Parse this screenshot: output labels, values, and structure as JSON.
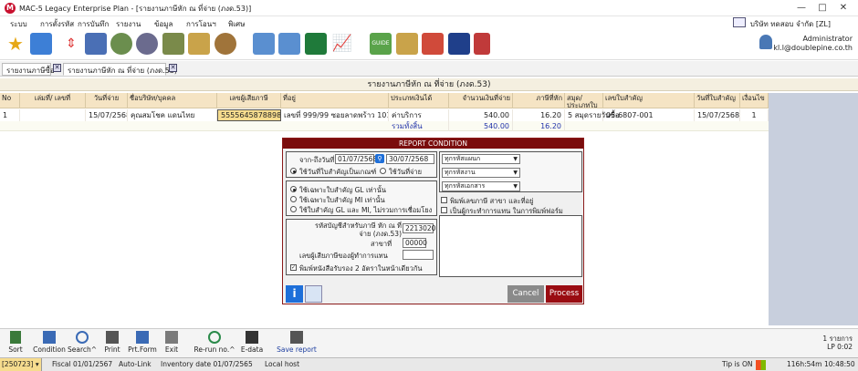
{
  "window": {
    "title": "MAC-5 Legacy Enterprise Plan - [รายงานภาษีหัก ณ ที่จ่าย (ภงด.53)]",
    "logo_letter": "M"
  },
  "menu": {
    "items": [
      "ระบบ",
      "การตั้งรหัส",
      "การบันทึก",
      "รายงาน",
      "ข้อมูล",
      "การโอนฯ",
      "พิเศษ"
    ]
  },
  "company": {
    "name": "บริษัท ทดสอบ จำกัด [ZL]"
  },
  "user": {
    "name": "Administrator",
    "email": "kl.l@doublepine.co.th"
  },
  "tabs": [
    {
      "label": "รายงานภาษีซื้อ"
    },
    {
      "label": "รายงานภาษีหัก ณ ที่จ่าย (ภงด.53)"
    }
  ],
  "report": {
    "title": "รายงานภาษีหัก ณ ที่จ่าย (ภงด.53)"
  },
  "table": {
    "columns": [
      "No",
      "เล่มที่/ เลขที่",
      "วันที่จ่าย",
      "ชื่อบริษัท/บุคคล",
      "เลขผู้เสียภาษี",
      "ที่อยู่",
      "ประเภทเงินได้",
      "จำนวนเงินที่จ่าย",
      "ภาษีที่หัก",
      "สมุด/ ประเภทใบสำคัญ",
      "เลขใบสำคัญ",
      "วันที่ใบสำคัญ",
      "เงื่อนไข"
    ],
    "row": [
      "1",
      "",
      "15/07/2568",
      "คุณสมโชค แดนไทย",
      "5555645878898",
      "เลขที่ 999/99 ซอยลาดพร้าว 101",
      "ค่าบริการ",
      "540.00",
      "16.20",
      "5 สมุดรายวันซื้อ",
      "05-6807-001",
      "15/07/2568",
      "1"
    ],
    "total": {
      "label": "รวมทั้งสิ้น",
      "amount": "540.00",
      "tax": "16.20"
    }
  },
  "dialog": {
    "title": "REPORT CONDITION",
    "date_label": "จาก-ถึงวันที่",
    "date_from": "01/07/2568",
    "date_to": "30/07/2568",
    "radio_date_doc": "ใช้วันที่ใบสำคัญเป็นเกณฑ์",
    "radio_date_pay": "ใช้วันที่จ่าย",
    "radio_gl": "ใช้เฉพาะใบสำคัญ GL เท่านั้น",
    "radio_mi": "ใช้เฉพาะใบสำคัญ MI เท่านั้น",
    "radio_both": "ใช้ใบสำคัญ GL และ MI, ไม่รวมการเชื่อมโยง",
    "account_label": "รหัสบัญชีสำหรับภาษี หัก ณ ที่จ่าย (ภงด.53)",
    "account_value": "2213020",
    "branch_label": "สาขาที่",
    "branch_value": "00000",
    "agent_label": "เลขผู้เสียภาษีของผู้ทำการแทน",
    "agent_value": "",
    "print_cert": "พิมพ์หนังสือรับรอง 2 อัตราในหน้าเดียวกัน",
    "select_dept": "ทุกรหัสแผนก",
    "select_job": "ทุกรหัสงาน",
    "select_doc": "ทุกรหัสเอกสาร",
    "chk_print_tax": "พิมพ์เลขภาษี สาขา และที่อยู่",
    "chk_agent": "เป็นผู้กระทำการแทน ในการพิมพ์ฟอร์ม",
    "cancel": "Cancel",
    "process": "Process",
    "info_glyph": "i"
  },
  "bottombar": {
    "items": [
      "Sort",
      "Condition",
      "Search^",
      "Print",
      "Prt.Form",
      "Exit",
      "Re-run no.^",
      "E-data",
      "Save report"
    ],
    "records": "1 รายการ",
    "lp": "LP 0:02"
  },
  "status": {
    "code": "[250723]",
    "fiscal": "Fiscal 01/01/2567",
    "autolink": "Auto-Link",
    "inventory": "Inventory date 01/07/2565",
    "host": "Local host",
    "tip": "Tip is ON",
    "uptime": "116h:54m",
    "clock": "10:48:50"
  },
  "colors": {
    "dialog_header": "#7a0d0d",
    "header_bg": "#f5e4c4",
    "selected_cell": "#f6dc8e",
    "process_btn": "#9a0c12",
    "cancel_btn": "#8a8a8a",
    "info_btn": "#1e6fd9"
  }
}
